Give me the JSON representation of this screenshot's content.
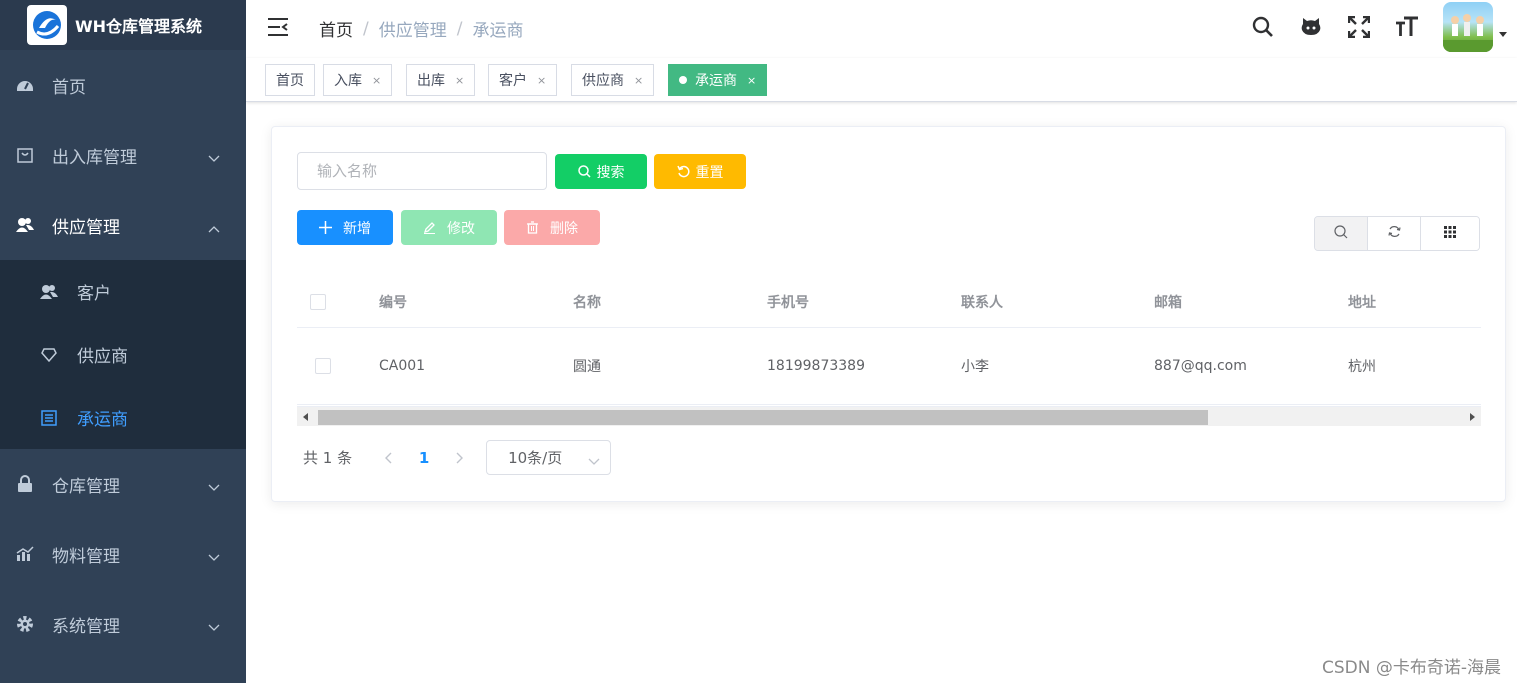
{
  "app": {
    "title": "WH仓库管理系统"
  },
  "sidebar": {
    "items": [
      {
        "label": "首页",
        "icon": "dashboard-icon"
      },
      {
        "label": "出入库管理",
        "icon": "shopping-icon"
      },
      {
        "label": "供应管理",
        "icon": "peoples-icon"
      },
      {
        "label": "仓库管理",
        "icon": "lock-icon"
      },
      {
        "label": "物料管理",
        "icon": "chart-icon"
      },
      {
        "label": "系统管理",
        "icon": "gear-icon"
      }
    ],
    "submenu": [
      {
        "label": "客户",
        "icon": "peoples-icon"
      },
      {
        "label": "供应商",
        "icon": "diamond-icon"
      },
      {
        "label": "承运商",
        "icon": "list-icon",
        "active": true
      }
    ]
  },
  "breadcrumb": {
    "home": "首页",
    "section": "供应管理",
    "current": "承运商",
    "separator": "/"
  },
  "tags": [
    {
      "label": "首页"
    },
    {
      "label": "入库",
      "close": "×"
    },
    {
      "label": "出库",
      "close": "×"
    },
    {
      "label": "客户",
      "close": "×"
    },
    {
      "label": "供应商",
      "close": "×"
    },
    {
      "label": "承运商",
      "close": "×",
      "active": true
    }
  ],
  "search": {
    "placeholder": "输入名称",
    "search_label": "搜索",
    "reset_label": "重置"
  },
  "toolbar": {
    "add_label": "新增",
    "edit_label": "修改",
    "delete_label": "删除"
  },
  "table": {
    "columns": [
      "编号",
      "名称",
      "手机号",
      "联系人",
      "邮箱",
      "地址"
    ],
    "rows": [
      [
        "CA001",
        "圆通",
        "18199873389",
        "小李",
        "887@qq.com",
        "杭州"
      ]
    ]
  },
  "pagination": {
    "total": "共 1 条",
    "current_page": "1",
    "page_size": "10条/页"
  },
  "watermark": "CSDN @卡布奇诺-海晨",
  "colors": {
    "sidebar_bg": "#304156",
    "active_blue": "#409eff",
    "tag_active": "#42b983",
    "search_green": "#13ce66",
    "reset_yellow": "#ffba00",
    "primary": "#1890ff"
  }
}
